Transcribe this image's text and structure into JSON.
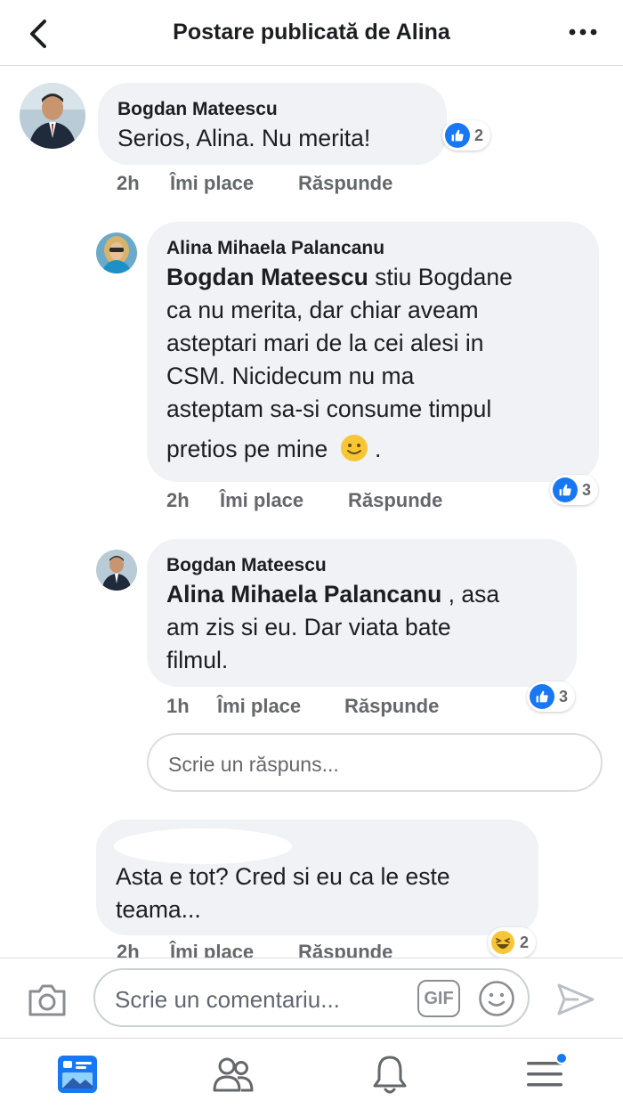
{
  "header": {
    "title": "Postare publicată de Alina"
  },
  "comments": [
    {
      "author": "Bogdan Mateescu",
      "text": "Serios, Alina. Nu merita!",
      "time": "2h",
      "like_label": "Îmi place",
      "reply_label": "Răspunde",
      "reaction": "like",
      "reaction_count": "2"
    },
    {
      "author": "Alina Mihaela Palancanu",
      "mention": "Bogdan Mateescu",
      "text_line1": " stiu Bogdane",
      "text_line2": "ca nu merita, dar chiar aveam",
      "text_line3": "asteptari mari de la cei alesi in",
      "text_line4": "CSM. Nicidecum nu ma",
      "text_line5": "asteptam sa-si consume timpul",
      "text_line6": "pretios pe mine",
      "text_end": ".",
      "time": "2h",
      "like_label": "Îmi place",
      "reply_label": "Răspunde",
      "reaction": "like",
      "reaction_count": "3"
    },
    {
      "author": "Bogdan Mateescu",
      "mention": "Alina Mihaela Palancanu",
      "text_line1": " , asa",
      "text_line2": "am zis si eu. Dar viata bate",
      "text_line3": "filmul.",
      "time": "1h",
      "like_label": "Îmi place",
      "reply_label": "Răspunde",
      "reaction": "like",
      "reaction_count": "3"
    },
    {
      "author": "",
      "text_line1": "Asta e tot? Cred si eu ca le este",
      "text_line2": "teama...",
      "time": "2h",
      "like_label": "Îmi place",
      "reply_label": "Răspunde",
      "reaction": "haha",
      "reaction_count": "2"
    }
  ],
  "reply_input": {
    "placeholder": "Scrie un răspuns..."
  },
  "composer": {
    "placeholder": "Scrie un comentariu...",
    "gif_label": "GIF"
  },
  "colors": {
    "accent": "#1877f2",
    "bubble": "#f0f2f5",
    "secondary_text": "#65676b"
  },
  "icons": [
    "back-arrow-icon",
    "more-dots-icon",
    "like-icon",
    "haha-icon",
    "camera-icon",
    "gif-icon",
    "emoji-icon",
    "send-icon",
    "news-feed-icon",
    "friends-icon",
    "notifications-bell-icon",
    "menu-icon"
  ]
}
